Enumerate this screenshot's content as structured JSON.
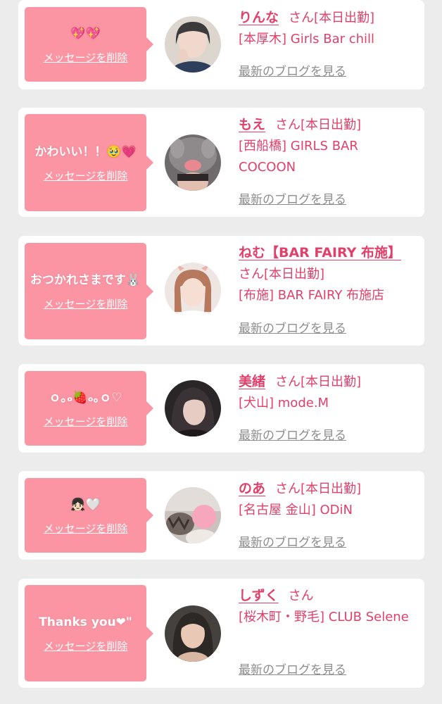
{
  "common": {
    "delete_label": "メッセージを削除",
    "honorific": "さん",
    "blog_link": "最新のブログを見る"
  },
  "entries": [
    {
      "message": "💖💖",
      "name": "りんな",
      "attendance": "[本日出勤]",
      "store": "[本厚木] Girls Bar chill"
    },
    {
      "message": "かわいい！！🥹💗",
      "name": "もえ",
      "attendance": "[本日出勤]",
      "store": "[西船橋] GIRLS BAR COCOON"
    },
    {
      "message": "おつかれさまです🐰",
      "name": "ねむ【BAR FAIRY 布施】",
      "attendance": "[本日出勤]",
      "store": "[布施] BAR FAIRY 布施店"
    },
    {
      "message": "ｏ｡ₒ🍓ₒ｡ｏ♡",
      "name": "美緒",
      "attendance": "[本日出勤]",
      "store": "[犬山] mode.M"
    },
    {
      "message": "👧🏻🤍",
      "name": "のあ",
      "attendance": "[本日出勤]",
      "store": "[名古屋 金山] ODiN"
    },
    {
      "message": "Thanks you❤︎\"",
      "name": "しずく",
      "attendance": "",
      "store": "[桜木町・野毛] CLUB Selene"
    }
  ]
}
